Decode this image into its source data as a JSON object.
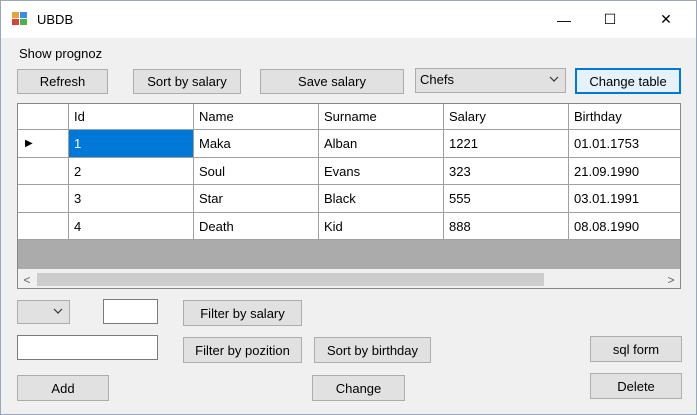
{
  "window": {
    "title": "UBDB",
    "minimize_glyph": "—",
    "maximize_glyph": "☐",
    "close_glyph": "✕"
  },
  "labels": {
    "show_prognoz": "Show prognoz"
  },
  "toolbar": {
    "refresh": "Refresh",
    "sort_salary": "Sort by salary",
    "save_salary": "Save salary",
    "table_select": "Chefs",
    "change_table": "Change table"
  },
  "grid": {
    "columns": [
      "Id",
      "Name",
      "Surname",
      "Salary",
      "Birthday"
    ],
    "rows": [
      [
        "1",
        "Maka",
        "Alban",
        "1221",
        "01.01.1753"
      ],
      [
        "2",
        "Soul",
        "Evans",
        "323",
        "21.09.1990"
      ],
      [
        "3",
        "Star",
        "Black",
        "555",
        "03.01.1991"
      ],
      [
        "4",
        "Death",
        "Kid",
        "888",
        "08.08.1990"
      ]
    ],
    "current_row_glyph": "▶",
    "scroll_left": "<",
    "scroll_right": ">"
  },
  "filters": {
    "operator_select": "",
    "salary_value": "",
    "filter_salary": "Filter by salary",
    "pozition_value": "",
    "filter_pozition": "Filter by pozition",
    "sort_birthday": "Sort by birthday"
  },
  "actions": {
    "sql_form": "sql form",
    "add": "Add",
    "change": "Change",
    "delete": "Delete"
  },
  "colors": {
    "accent": "#0078d7",
    "button_face": "#e1e1e1",
    "grid_back": "#ababab"
  }
}
